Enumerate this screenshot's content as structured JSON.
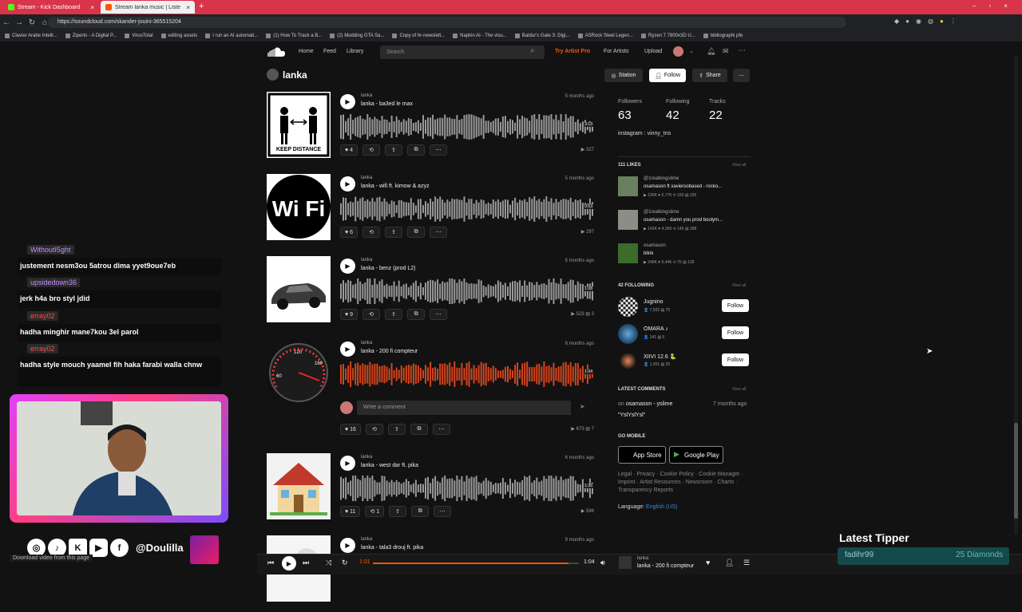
{
  "browser": {
    "tabs": [
      {
        "label": "Stream - Kick Dashboard",
        "active": false
      },
      {
        "label": "Stream lanka music | Listen ...",
        "active": true
      }
    ],
    "url": "https://soundcloud.com/skander-jouini-365515204",
    "bookmarks": [
      "Clavier Arabe Intelli...",
      "Ziperto - A Digital P...",
      "VirusTotal",
      "editing assets",
      "I run an AI automati...",
      "(1) How To Track a B...",
      "(2) Modding GTA Sa...",
      "Copy of hr-newslett...",
      "Napkin AI - The visu...",
      "Baldur's Gate 3: Digi...",
      "ASRock Steel Legen...",
      "Ryzen 7 7800x3D U...",
      "bibliographi pfe"
    ]
  },
  "sc_header": {
    "nav": [
      "Home",
      "Feed",
      "Library"
    ],
    "search_placeholder": "Search",
    "try_pro": "Try Artist Pro",
    "for_artists": "For Artists",
    "upload": "Upload"
  },
  "profile": {
    "title": "lanka",
    "station": "Station",
    "follow": "Follow",
    "share": "Share",
    "stats": [
      {
        "label": "Followers",
        "value": "63"
      },
      {
        "label": "Following",
        "value": "42"
      },
      {
        "label": "Tracks",
        "value": "22"
      }
    ],
    "bio": "instagram : vinny_tns"
  },
  "tracks": [
    {
      "artist": "lanka",
      "title": "lanka - ba3ed le max",
      "date": "5 months ago",
      "likes": "4",
      "reposts": "",
      "plays": "327",
      "comments": "",
      "duration": "3:13",
      "cover": "keep"
    },
    {
      "artist": "lanka",
      "title": "lanka - wifi ft. kimow & azyz",
      "date": "5 months ago",
      "likes": "6",
      "reposts": "",
      "plays": "297",
      "comments": "",
      "duration": "0:53",
      "cover": "wifi"
    },
    {
      "artist": "lanka",
      "title": "lanka - benz (prod L2)",
      "date": "5 months ago",
      "likes": "9",
      "reposts": "",
      "plays": "523",
      "comments": "3",
      "duration": "1:08",
      "cover": "car"
    },
    {
      "artist": "lanka",
      "title": "lanka - 200 fi compteur",
      "date": "6 months ago",
      "likes": "16",
      "reposts": "",
      "plays": "673",
      "comments": "7",
      "duration": "1:04",
      "cover": "gauge",
      "comment_placeholder": "Write a comment",
      "elapsed": "1:01"
    },
    {
      "artist": "lanka",
      "title": "lanka - west dar ft. pika",
      "date": "6 months ago",
      "likes": "11",
      "reposts": "1",
      "plays": "586",
      "comments": "",
      "duration": "1:36",
      "cover": "house"
    },
    {
      "artist": "lanka",
      "title": "lanka - tala3 drouj ft. pika",
      "date": "9 months ago",
      "likes": "",
      "reposts": "",
      "plays": "",
      "comments": "",
      "duration": "",
      "cover": "white"
    }
  ],
  "likes_section": {
    "header": "111 LIKES",
    "view_all": "View all",
    "items": [
      {
        "user": "@1realkingslime",
        "title": "osamason ft xaviersobased - rocko...",
        "stats": "▶ 190K  ♥ 5,776  ⟲ 180  ▤ 295"
      },
      {
        "user": "@1realkingslime",
        "title": "osamason - damn you prod boolym...",
        "stats": "▶ 143K  ♥ 4,369  ⟲ 146  ▤ 288"
      },
      {
        "user": "osamason",
        "title": "blink",
        "stats": "▶ 248K  ♥ 5,446  ⟲ 75  ▤ 128"
      }
    ]
  },
  "following_section": {
    "header": "42 FOLLOWING",
    "view_all": "View all",
    "follow_label": "Follow",
    "items": [
      {
        "name": "Jugnino",
        "stats": "👤 7,502  ▤ 75"
      },
      {
        "name": "OMARA ♪",
        "stats": "👤 141  ▤ 5"
      },
      {
        "name": "XIIVI 12.6 🐍",
        "stats": "👤 1,951  ▤ 26"
      }
    ]
  },
  "comments_section": {
    "header": "LATEST COMMENTS",
    "view_all": "View all",
    "on": "on",
    "track": "osamason - yslime",
    "date": "7 months ago",
    "text": "\"YslYslYsl\""
  },
  "go_mobile": {
    "header": "GO MOBILE",
    "app_store": "App Store",
    "google_play": "Google Play"
  },
  "footer": {
    "links": "Legal · Privacy · Cookie Policy · Cookie Manager · Imprint · Artist Resources · Newsroom · Charts · Transparency Reports",
    "language_label": "Language:",
    "language": "English (US)"
  },
  "player": {
    "elapsed": "1:01",
    "total": "1:04",
    "progress": 0.95,
    "artist": "lanka",
    "title": "lanka - 200 fi compteur"
  },
  "stream_overlay": {
    "chat": [
      {
        "user": "WithoutI5ght",
        "msg": "justement nesm3ou 5atrou dima yyet9oue7eb",
        "color": "#c58cff"
      },
      {
        "user": "upsidedown36",
        "msg": "jerk h4a bro styl jdid",
        "color": "#c58cff"
      },
      {
        "user": "erray02",
        "msg": "hadha minghir mane7kou 3el parol",
        "color": "#ff4a4a"
      },
      {
        "user": "erray02",
        "msg": "hadha style mouch yaamel fih haka farabi walla chnw",
        "color": "#ff4a4a"
      }
    ],
    "handle": "@Doulilla",
    "download_text": "Download video from this page",
    "latest_tipper_title": "Latest Tipper",
    "tipper_name": "fadihr99",
    "tipper_amount": "25 Diamonds"
  },
  "colors": {
    "accent": "#ff5500",
    "tabbar": "#d8344a"
  }
}
